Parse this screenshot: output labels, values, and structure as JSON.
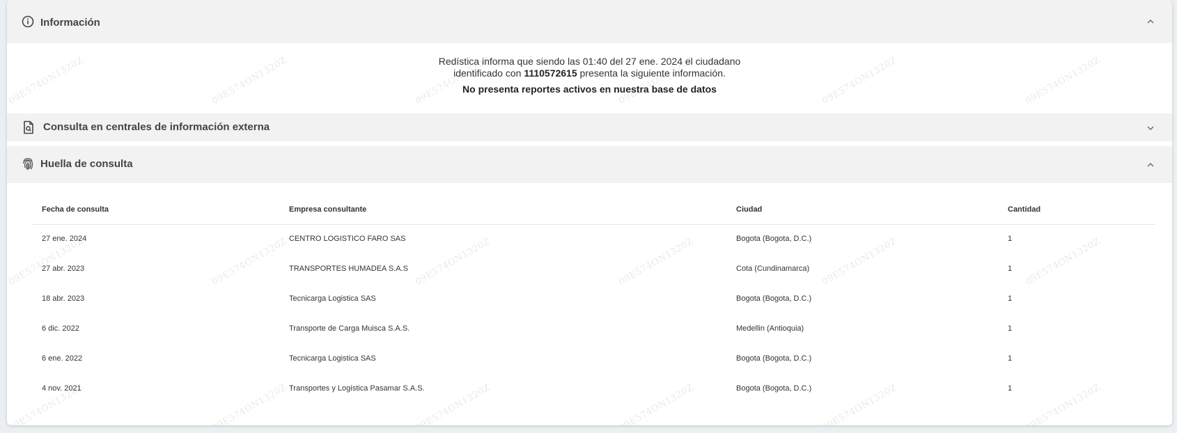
{
  "sections": {
    "informacion": {
      "title": "Información",
      "icon": "info-circle-icon",
      "chevron": "chevron-up-icon"
    },
    "consulta_externa": {
      "title": "Consulta en centrales de información externa",
      "icon": "document-search-icon",
      "chevron": "chevron-down-icon"
    },
    "huella": {
      "title": "Huella de consulta",
      "icon": "fingerprint-icon",
      "chevron": "chevron-up-icon"
    }
  },
  "info": {
    "line1": "Redística informa que siendo las 01:40 del 27 ene. 2024 el ciudadano",
    "line2_prefix": "identificado con ",
    "document_id": "1110572615",
    "line2_suffix": " presenta la siguiente información.",
    "status": "No presenta reportes activos en nuestra base de datos"
  },
  "table": {
    "headers": [
      "Fecha de consulta",
      "Empresa consultante",
      "Ciudad",
      "Cantidad"
    ],
    "rows": [
      [
        "27 ene. 2024",
        "CENTRO LOGISTICO FARO SAS",
        "Bogota (Bogota, D.C.)",
        "1"
      ],
      [
        "27 abr. 2023",
        "TRANSPORTES HUMADEA S.A.S",
        "Cota (Cundinamarca)",
        "1"
      ],
      [
        "18 abr. 2023",
        "Tecnicarga Logistica SAS",
        "Bogota (Bogota, D.C.)",
        "1"
      ],
      [
        "6 dic. 2022",
        "Transporte de Carga Muisca S.A.S.",
        "Medellin (Antioquia)",
        "1"
      ],
      [
        "6 ene. 2022",
        "Tecnicarga Logistica SAS",
        "Bogota (Bogota, D.C.)",
        "1"
      ],
      [
        "4 nov. 2021",
        "Transportes y Logistica Pasamar S.A.S.",
        "Bogota (Bogota, D.C.)",
        "1"
      ]
    ]
  },
  "watermark": "09E574ON1320Z",
  "colors": {
    "header_bg": "#f2f2f2",
    "page_bg": "#eceff1",
    "card_bg": "#ffffff"
  }
}
